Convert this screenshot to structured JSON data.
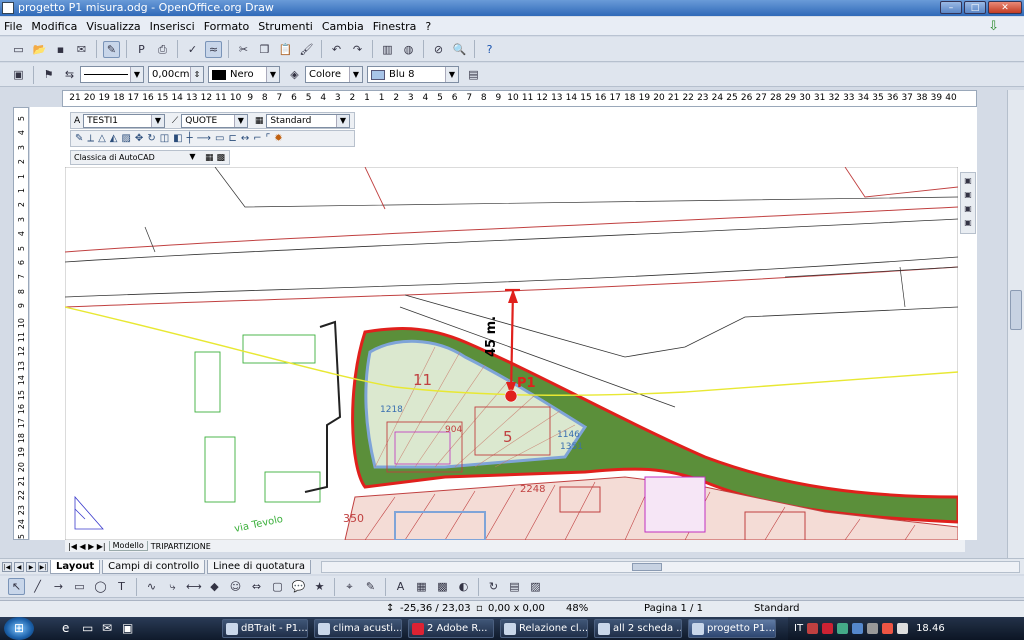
{
  "window": {
    "title": "progetto P1 misura.odg - OpenOffice.org Draw"
  },
  "menu": [
    "File",
    "Modifica",
    "Visualizza",
    "Inserisci",
    "Formato",
    "Strumenti",
    "Cambia",
    "Finestra",
    "?"
  ],
  "line_toolbar": {
    "width_value": "0,00cm",
    "line_color": "Nero",
    "fill_type": "Colore",
    "fill_color": "Blu 8"
  },
  "ruler": {
    "h": [
      "21",
      "20",
      "19",
      "18",
      "17",
      "16",
      "15",
      "14",
      "13",
      "12",
      "11",
      "10",
      "9",
      "8",
      "7",
      "6",
      "5",
      "4",
      "3",
      "2",
      "1",
      "1",
      "2",
      "3",
      "4",
      "5",
      "6",
      "7",
      "8",
      "9",
      "10",
      "11",
      "12",
      "13",
      "14",
      "15",
      "16",
      "17",
      "18",
      "19",
      "20",
      "21",
      "22",
      "23",
      "24",
      "25",
      "26",
      "27",
      "28",
      "29",
      "30",
      "31",
      "32",
      "33",
      "34",
      "35",
      "36",
      "37",
      "38",
      "39",
      "40"
    ],
    "v": [
      "5",
      "4",
      "3",
      "2",
      "1",
      "1",
      "2",
      "3",
      "4",
      "5",
      "6",
      "7",
      "8",
      "9",
      "10",
      "11",
      "12",
      "13",
      "14",
      "15",
      "16",
      "17",
      "18",
      "19",
      "20",
      "21",
      "22",
      "23",
      "24",
      "25"
    ]
  },
  "cad_toolbar": {
    "text_style": "TESTI1",
    "dim_style": "QUOTE",
    "line_style": "Standard",
    "theme": "Classica di AutoCAD"
  },
  "drawing": {
    "dim_label": "45 m.",
    "point_label": "P1",
    "lots": [
      "11",
      "5",
      "1218",
      "1146",
      "1351",
      "904",
      "2248",
      "350"
    ],
    "street": "via Tevolo"
  },
  "model_tabs": [
    "Modello",
    "TRIPARTIZIONE"
  ],
  "layer_tabs": [
    "Layout",
    "Campi di controllo",
    "Linee di quotatura"
  ],
  "status": {
    "position": "-25,36 / 23,03",
    "size": "0,00 x 0,00",
    "zoom": "48%",
    "page": "Pagina 1 / 1",
    "style": "Standard"
  },
  "taskbar": {
    "tasks": [
      "dBTrait - P1...",
      "clima acusti...",
      "2 Adobe R...",
      "Relazione cl...",
      "all 2 scheda ...",
      "progetto P1..."
    ],
    "lang": "IT",
    "time": "18.46"
  },
  "colors": {
    "green_area": "#5b8f3a",
    "red_line": "#e0201c",
    "yellow_line": "#e8e833",
    "blue_outline": "#7fa4d8"
  }
}
